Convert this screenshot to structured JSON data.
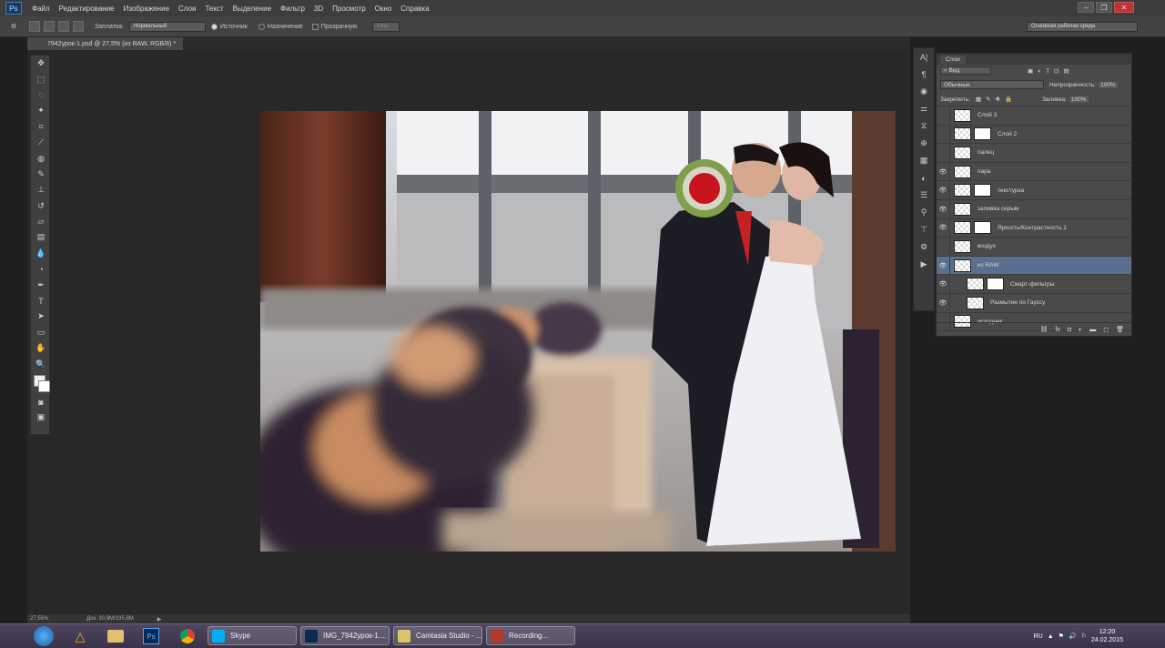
{
  "menubar": {
    "logo": "Ps",
    "items": [
      "Файл",
      "Редактирование",
      "Изображение",
      "Слои",
      "Текст",
      "Выделение",
      "Фильтр",
      "3D",
      "Просмотр",
      "Окно",
      "Справка"
    ]
  },
  "options": {
    "fill_label": "Заплатка:",
    "mode_value": "Нормальный",
    "source_label": "Источник",
    "dest_label": "Назначение",
    "transparent_label": "Прозрачную",
    "use_pattern_label": "Узор",
    "workspace": "Основная рабочая среда"
  },
  "document": {
    "tab_title": "7942урок-1.psd @ 27,5% (из RAW, RGB/8) *"
  },
  "status": {
    "zoom": "27,55%",
    "doc_size": "Док: 30,9M/335,8M"
  },
  "layers_panel": {
    "tab": "Слои",
    "kind_label": "Вид",
    "blend_mode": "Обычные",
    "opacity_label": "Непрозрачность:",
    "opacity_value": "100%",
    "lock_label": "Закрепить:",
    "fill_label": "Заливка:",
    "fill_value": "100%",
    "layers": [
      {
        "name": "Слой 3",
        "visible": false,
        "has_mask": false
      },
      {
        "name": "Слой 2",
        "visible": false,
        "has_mask": true
      },
      {
        "name": "палец",
        "visible": false,
        "has_mask": false
      },
      {
        "name": "пара",
        "visible": true,
        "has_mask": false
      },
      {
        "name": "текстурка",
        "visible": true,
        "has_mask": true
      },
      {
        "name": "заливка серым",
        "visible": true,
        "has_mask": false
      },
      {
        "name": "Яркость/Контрастность 1",
        "visible": true,
        "has_mask": true
      },
      {
        "name": "воздух",
        "visible": false,
        "has_mask": false
      },
      {
        "name": "из RAW",
        "visible": true,
        "has_mask": false,
        "selected": true
      },
      {
        "name": "Смарт-фильтры",
        "visible": true,
        "has_mask": true
      },
      {
        "name": "Размытие по Гауссу",
        "visible": true,
        "has_mask": false
      },
      {
        "name": "исходник",
        "visible": false,
        "has_mask": false
      }
    ]
  },
  "taskbar": {
    "tasks": [
      {
        "label": "Skype",
        "color": "#00aff0"
      },
      {
        "label": "IMG_7942урок-1....",
        "color": "#0a2a52"
      },
      {
        "label": "Camtasia Studio - ...",
        "color": "#d8c46a"
      },
      {
        "label": "Recording...",
        "color": "#b33a2a"
      }
    ],
    "lang": "RU",
    "time": "12:20",
    "date": "24.02.2015"
  }
}
